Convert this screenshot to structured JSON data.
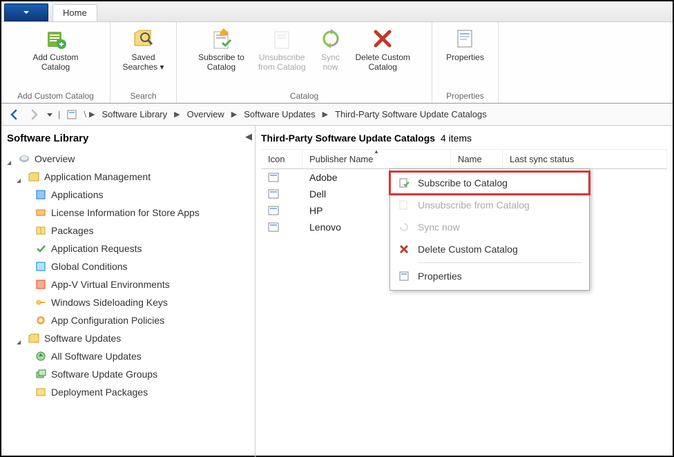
{
  "tabbar": {
    "home": "Home"
  },
  "ribbon": {
    "groups": [
      {
        "title": "Add Custom Catalog",
        "items": [
          {
            "label": "Add Custom\nCatalog",
            "icon": "catalog-add-icon"
          }
        ]
      },
      {
        "title": "Search",
        "items": [
          {
            "label": "Saved\nSearches ▾",
            "icon": "search-saved-icon"
          }
        ]
      },
      {
        "title": "Catalog",
        "items": [
          {
            "label": "Subscribe to\nCatalog",
            "icon": "subscribe-icon"
          },
          {
            "label": "Unsubscribe\nfrom Catalog",
            "icon": "unsubscribe-icon",
            "disabled": true
          },
          {
            "label": "Sync\nnow",
            "icon": "sync-icon",
            "disabled": true
          },
          {
            "label": "Delete Custom\nCatalog",
            "icon": "delete-icon"
          }
        ]
      },
      {
        "title": "Properties",
        "items": [
          {
            "label": "Properties",
            "icon": "properties-icon"
          }
        ]
      }
    ]
  },
  "breadcrumb": {
    "items": [
      "Software Library",
      "Overview",
      "Software Updates",
      "Third-Party Software Update Catalogs"
    ]
  },
  "sidebar": {
    "title": "Software Library",
    "overview": "Overview",
    "app_mgmt": "Application Management",
    "app_children": [
      "Applications",
      "License Information for Store Apps",
      "Packages",
      "Application Requests",
      "Global Conditions",
      "App-V Virtual Environments",
      "Windows Sideloading Keys",
      "App Configuration Policies"
    ],
    "sw_updates": "Software Updates",
    "sw_children": [
      "All Software Updates",
      "Software Update Groups",
      "Deployment Packages"
    ]
  },
  "content": {
    "title_prefix": "Third-Party Software Update Catalogs",
    "title_suffix": "4 items",
    "columns": {
      "icon": "Icon",
      "publisher": "Publisher Name",
      "name": "Name",
      "sync": "Last sync status"
    },
    "rows": [
      {
        "publisher": "Adobe"
      },
      {
        "publisher": "Dell"
      },
      {
        "publisher": "HP"
      },
      {
        "publisher": "Lenovo"
      }
    ]
  },
  "context_menu": {
    "subscribe": "Subscribe to Catalog",
    "unsubscribe": "Unsubscribe from Catalog",
    "sync": "Sync now",
    "delete": "Delete Custom Catalog",
    "properties": "Properties"
  }
}
